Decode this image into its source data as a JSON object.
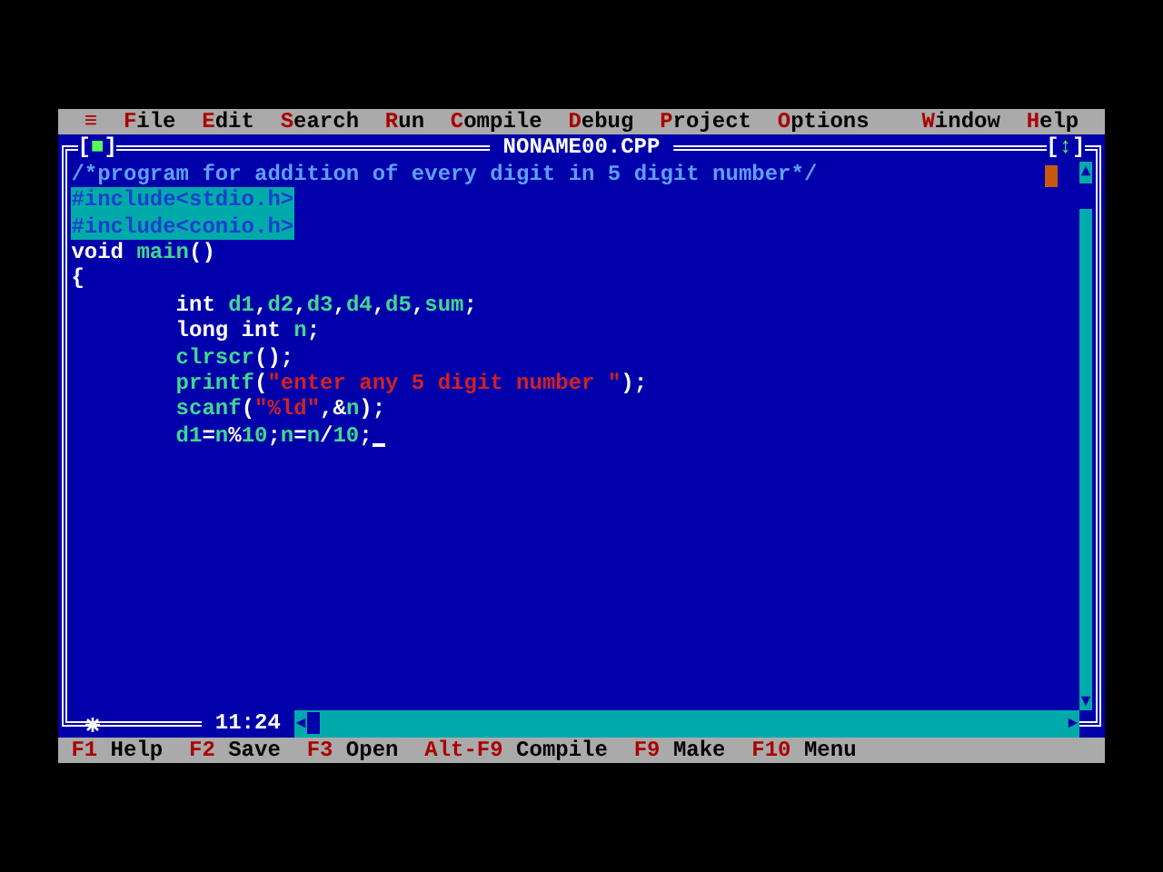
{
  "menu_bar": {
    "system_menu": "≡",
    "left_items": [
      "File",
      "Edit",
      "Search",
      "Run",
      "Compile",
      "Debug",
      "Project",
      "Options"
    ],
    "right_items": [
      "Window",
      "Help"
    ]
  },
  "editor": {
    "title": "NONAME00.CPP",
    "close_box": "[■]",
    "zoom_box": "[↕]",
    "modified": true,
    "position": "11:24",
    "lines": [
      {
        "indented": false,
        "selected": false,
        "cursor": false,
        "tokens": [
          {
            "t": "/*program for addition of every digit in 5 digit number*/",
            "kind": "comment"
          }
        ]
      },
      {
        "indented": false,
        "selected": true,
        "cursor": false,
        "tokens": [
          {
            "t": "#include<stdio.h>",
            "kind": "preproc"
          }
        ]
      },
      {
        "indented": false,
        "selected": true,
        "cursor": false,
        "tokens": [
          {
            "t": "#include<conio.h>",
            "kind": "preproc"
          }
        ]
      },
      {
        "indented": false,
        "selected": false,
        "cursor": false,
        "tokens": [
          {
            "t": "void ",
            "kind": "keyword"
          },
          {
            "t": "main",
            "kind": "ident"
          },
          {
            "t": "()",
            "kind": "punct"
          }
        ]
      },
      {
        "indented": false,
        "selected": false,
        "cursor": false,
        "tokens": [
          {
            "t": "{",
            "kind": "punct"
          }
        ]
      },
      {
        "indented": true,
        "selected": false,
        "cursor": false,
        "tokens": [
          {
            "t": "int ",
            "kind": "keyword"
          },
          {
            "t": "d1",
            "kind": "ident"
          },
          {
            "t": ",",
            "kind": "punct"
          },
          {
            "t": "d2",
            "kind": "ident"
          },
          {
            "t": ",",
            "kind": "punct"
          },
          {
            "t": "d3",
            "kind": "ident"
          },
          {
            "t": ",",
            "kind": "punct"
          },
          {
            "t": "d4",
            "kind": "ident"
          },
          {
            "t": ",",
            "kind": "punct"
          },
          {
            "t": "d5",
            "kind": "ident"
          },
          {
            "t": ",",
            "kind": "punct"
          },
          {
            "t": "sum",
            "kind": "ident"
          },
          {
            "t": ";",
            "kind": "punct"
          }
        ]
      },
      {
        "indented": true,
        "selected": false,
        "cursor": false,
        "tokens": [
          {
            "t": "long int ",
            "kind": "keyword"
          },
          {
            "t": "n",
            "kind": "ident"
          },
          {
            "t": ";",
            "kind": "punct"
          }
        ]
      },
      {
        "indented": true,
        "selected": false,
        "cursor": false,
        "tokens": [
          {
            "t": "clrscr",
            "kind": "ident"
          },
          {
            "t": "();",
            "kind": "punct"
          }
        ]
      },
      {
        "indented": true,
        "selected": false,
        "cursor": false,
        "tokens": [
          {
            "t": "printf",
            "kind": "ident"
          },
          {
            "t": "(",
            "kind": "punct"
          },
          {
            "t": "\"enter any 5 digit number \"",
            "kind": "string"
          },
          {
            "t": ");",
            "kind": "punct"
          }
        ]
      },
      {
        "indented": true,
        "selected": false,
        "cursor": false,
        "tokens": [
          {
            "t": "scanf",
            "kind": "ident"
          },
          {
            "t": "(",
            "kind": "punct"
          },
          {
            "t": "\"%ld\"",
            "kind": "string"
          },
          {
            "t": ",&",
            "kind": "punct"
          },
          {
            "t": "n",
            "kind": "ident"
          },
          {
            "t": ");",
            "kind": "punct"
          }
        ]
      },
      {
        "indented": true,
        "selected": false,
        "cursor": true,
        "tokens": [
          {
            "t": "d1",
            "kind": "ident"
          },
          {
            "t": "=",
            "kind": "punct"
          },
          {
            "t": "n",
            "kind": "ident"
          },
          {
            "t": "%",
            "kind": "punct"
          },
          {
            "t": "10",
            "kind": "number"
          },
          {
            "t": ";",
            "kind": "punct"
          },
          {
            "t": "n",
            "kind": "ident"
          },
          {
            "t": "=",
            "kind": "punct"
          },
          {
            "t": "n",
            "kind": "ident"
          },
          {
            "t": "/",
            "kind": "punct"
          },
          {
            "t": "10",
            "kind": "number"
          },
          {
            "t": ";",
            "kind": "punct"
          }
        ]
      }
    ]
  },
  "status_bar": [
    {
      "key": "F1",
      "label": "Help"
    },
    {
      "key": "F2",
      "label": "Save"
    },
    {
      "key": "F3",
      "label": "Open"
    },
    {
      "key": "Alt-F9",
      "label": "Compile"
    },
    {
      "key": "F9",
      "label": "Make"
    },
    {
      "key": "F10",
      "label": "Menu"
    }
  ]
}
